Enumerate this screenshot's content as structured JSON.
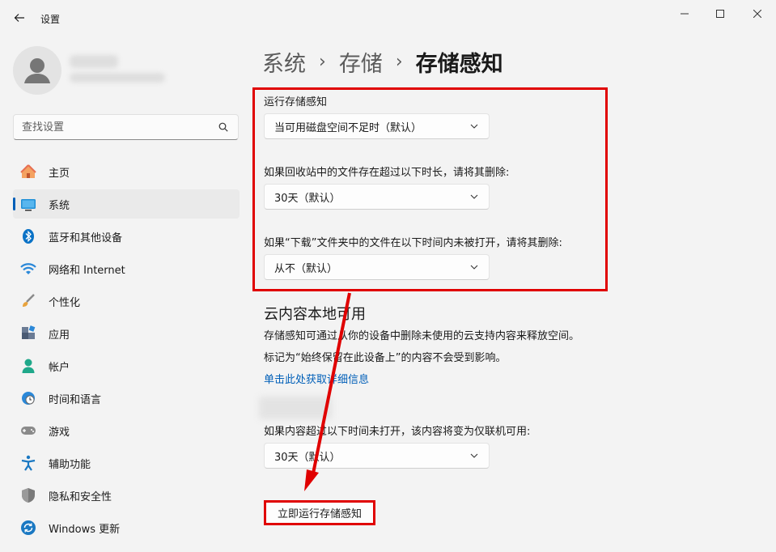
{
  "app": {
    "title": "设置"
  },
  "search": {
    "placeholder": "查找设置"
  },
  "sidebar": {
    "items": [
      {
        "label": "主页"
      },
      {
        "label": "系统"
      },
      {
        "label": "蓝牙和其他设备"
      },
      {
        "label": "网络和 Internet"
      },
      {
        "label": "个性化"
      },
      {
        "label": "应用"
      },
      {
        "label": "帐户"
      },
      {
        "label": "时间和语言"
      },
      {
        "label": "游戏"
      },
      {
        "label": "辅助功能"
      },
      {
        "label": "隐私和安全性"
      },
      {
        "label": "Windows 更新"
      }
    ]
  },
  "breadcrumb": {
    "level1": "系统",
    "level2": "存储",
    "current": "存储感知"
  },
  "settings": {
    "run_label": "运行存储感知",
    "run_value": "当可用磁盘空间不足时（默认）",
    "recycle_label": "如果回收站中的文件存在超过以下时长，请将其删除:",
    "recycle_value": "30天（默认）",
    "downloads_label": "如果“下载”文件夹中的文件在以下时间内未被打开，请将其删除:",
    "downloads_value": "从不（默认）"
  },
  "cloud": {
    "title": "云内容本地可用",
    "desc1": "存储感知可通过从你的设备中删除未使用的云支持内容来释放空间。",
    "desc2": "标记为“始终保留在此设备上”的内容不会受到影响。",
    "link": "单击此处获取详细信息",
    "offline_label": "如果内容超过以下时间未打开，该内容将变为仅联机可用:",
    "offline_value": "30天（默认）"
  },
  "actions": {
    "run_now": "立即运行存储感知"
  },
  "colors": {
    "accent": "#005fb8",
    "annotation_red": "#e00000"
  }
}
